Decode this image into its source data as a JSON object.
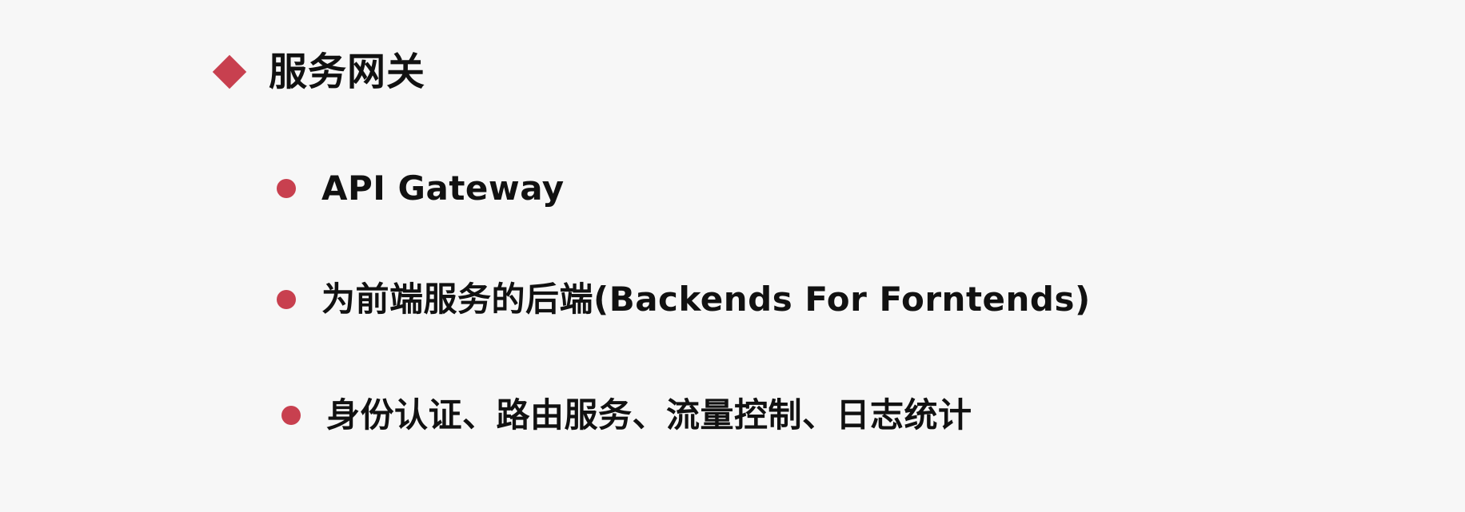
{
  "slide": {
    "heading": "服务网关",
    "accent_color": "#c8404f",
    "bullets": [
      {
        "text": "API Gateway"
      },
      {
        "text": "为前端服务的后端(Backends For Forntends)"
      },
      {
        "text": "身份认证、路由服务、流量控制、日志统计"
      }
    ]
  }
}
